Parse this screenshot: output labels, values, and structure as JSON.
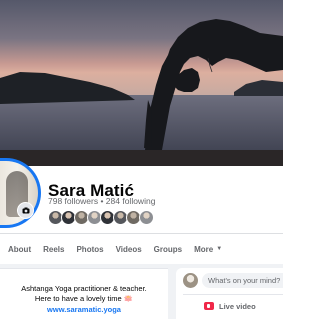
{
  "profile": {
    "name": "Sara Matić",
    "followers": "798 followers",
    "separator": " • ",
    "following": "284 following",
    "friend_count_shown": 8
  },
  "tabs": [
    {
      "label": "About"
    },
    {
      "label": "Reels"
    },
    {
      "label": "Photos"
    },
    {
      "label": "Videos"
    },
    {
      "label": "Groups"
    },
    {
      "label": "More"
    }
  ],
  "intro": {
    "bio_line1": "Ashtanga Yoga practitioner & teacher.",
    "bio_line2": "Here to have a lovely time 🪷",
    "link": "www.saramatic.yoga"
  },
  "composer": {
    "placeholder": "What's on your mind?",
    "live_label": "Live video"
  },
  "colors": {
    "accent": "#1877f2",
    "live_red": "#f02849",
    "muted_text": "#65676b"
  },
  "icons": [
    "camera-icon",
    "live-video-icon",
    "caret-down-icon"
  ]
}
